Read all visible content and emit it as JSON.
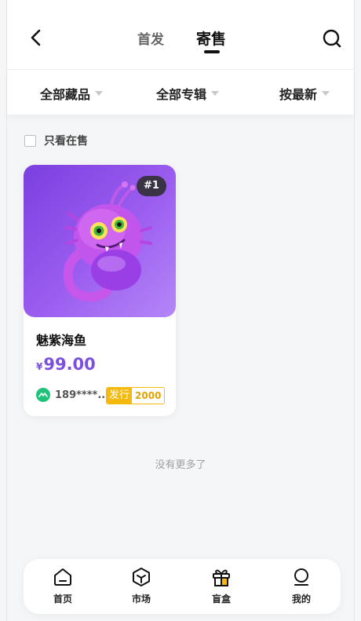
{
  "header": {
    "tabs": [
      {
        "label": "首发",
        "active": false
      },
      {
        "label": "寄售",
        "active": true
      }
    ]
  },
  "filters": [
    {
      "label": "全部藏品"
    },
    {
      "label": "全部专辑"
    },
    {
      "label": "按最新"
    }
  ],
  "only_on_sale": {
    "label": "只看在售",
    "checked": false
  },
  "items": [
    {
      "rank": "#1",
      "title": "魅紫海鱼",
      "currency": "¥",
      "price": "99.00",
      "owner": "189****...",
      "issue_label": "发行",
      "issue_count": "2000"
    }
  ],
  "no_more_text": "没有更多了",
  "bottom_nav": [
    {
      "label": "首页",
      "icon": "home-icon"
    },
    {
      "label": "市场",
      "icon": "market-box-icon"
    },
    {
      "label": "盲盒",
      "icon": "gift-box-icon"
    },
    {
      "label": "我的",
      "icon": "profile-icon"
    }
  ],
  "colors": {
    "accent": "#7b4fe0",
    "issue": "#f5b90d",
    "avatar": "#1ec27a"
  }
}
